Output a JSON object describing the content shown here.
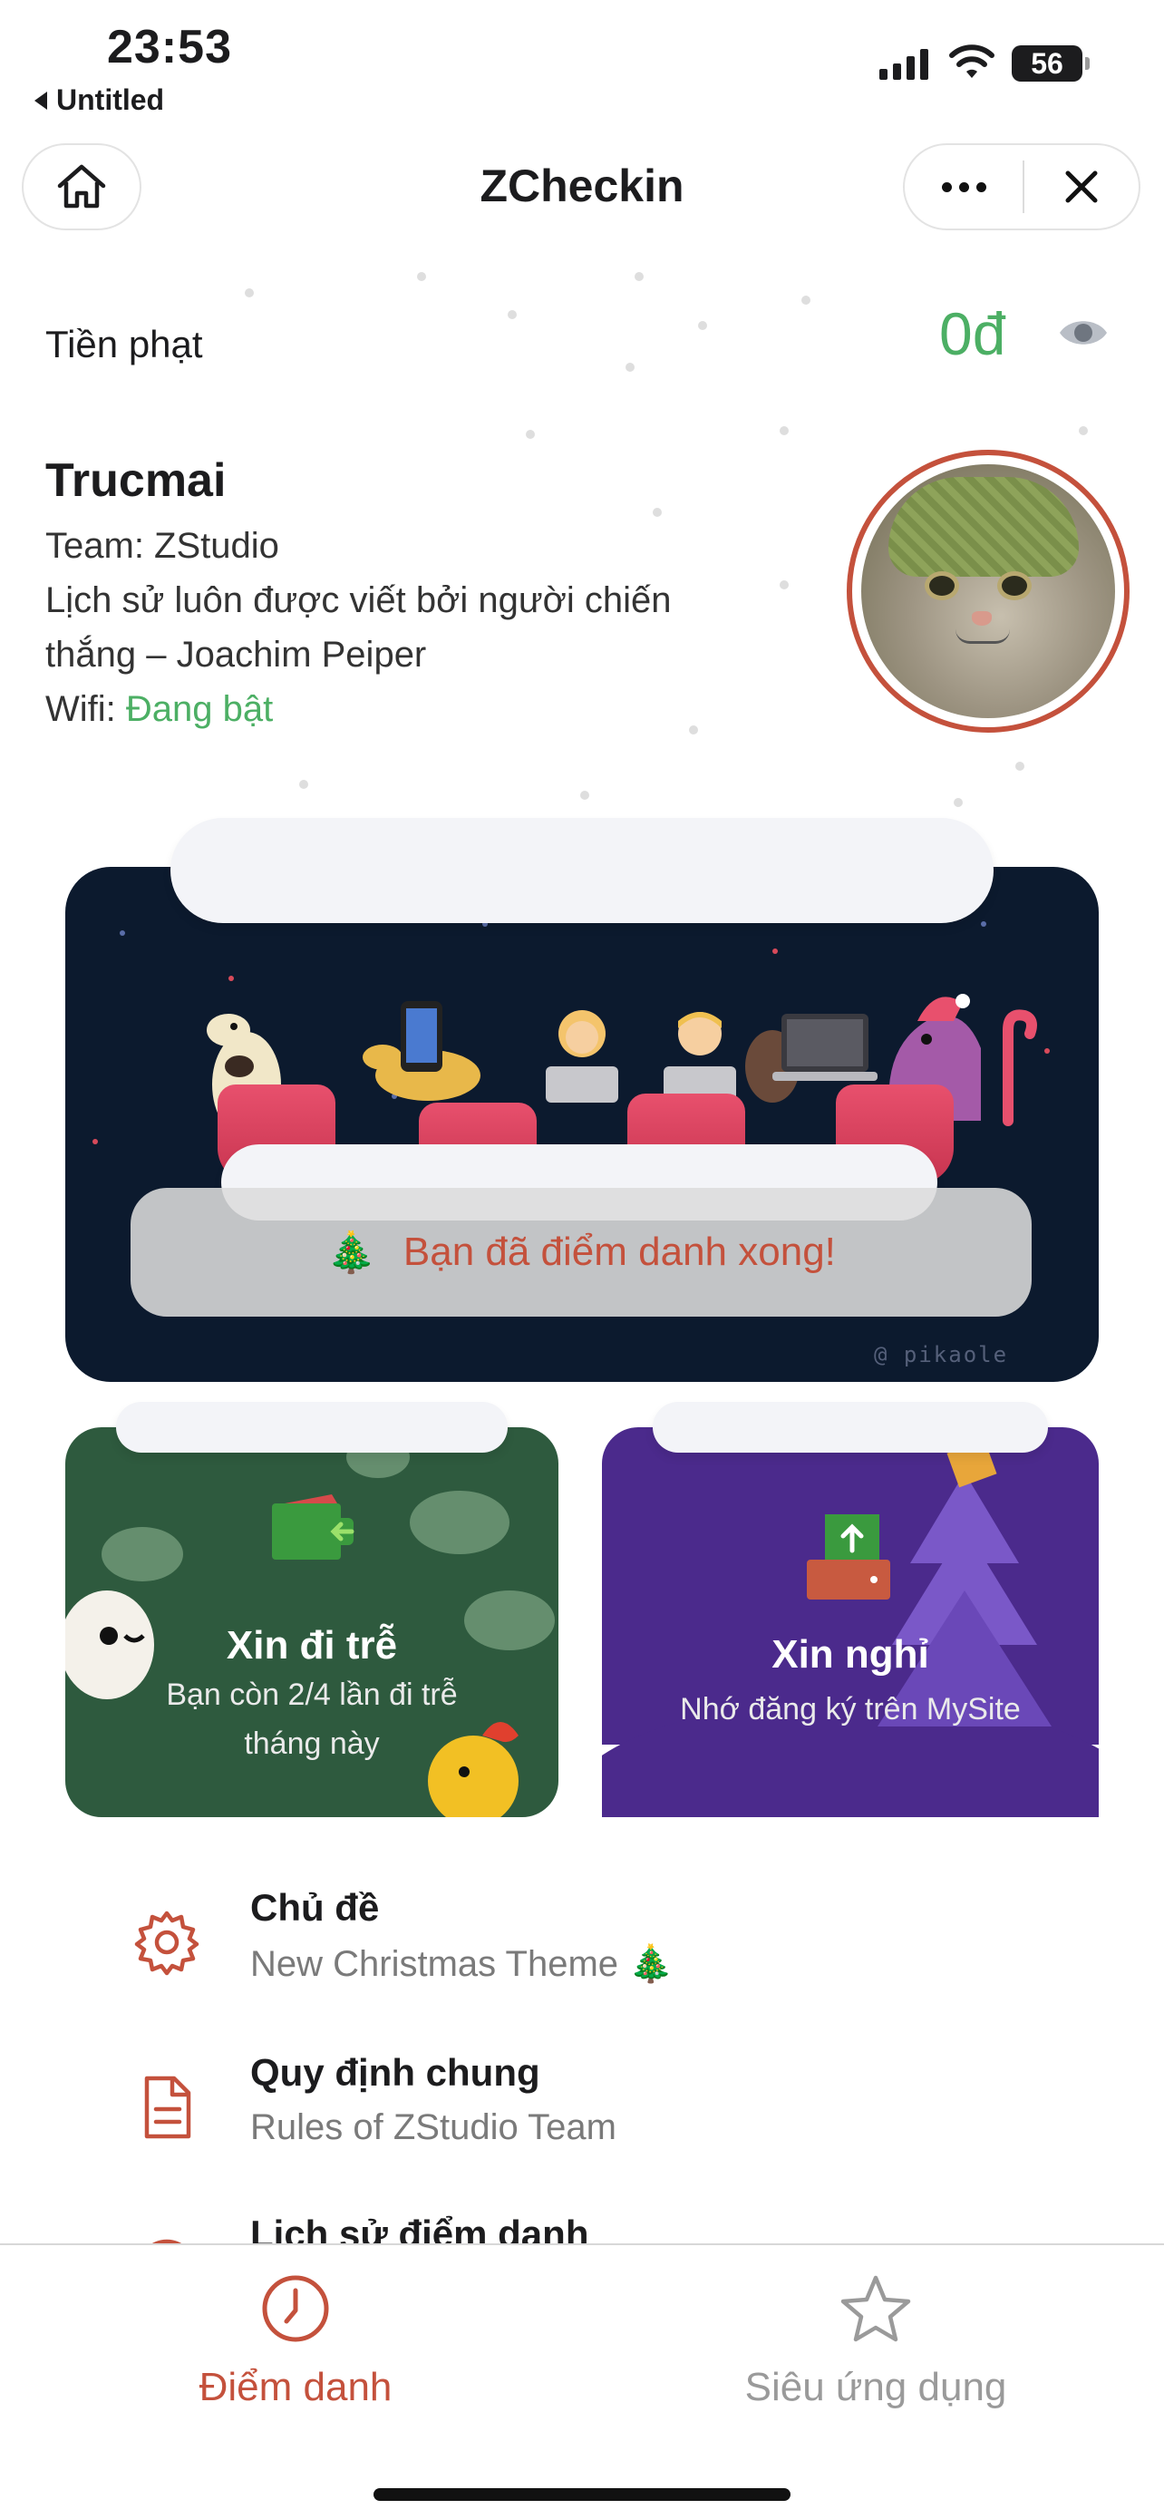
{
  "status_bar": {
    "time": "23:53",
    "back_app": "Untitled",
    "battery": "56"
  },
  "nav": {
    "title": "ZCheckin"
  },
  "fine": {
    "label": "Tiền phạt",
    "value": "0đ"
  },
  "profile": {
    "name": "Trucmai",
    "team": "Team: ZStudio",
    "quote_line1": "Lịch sử luôn được viết bởi người chiến",
    "quote_line2": "thắng – Joachim Peiper",
    "wifi_label": "Wifi: ",
    "wifi_status": "Đang bật"
  },
  "checkin_card": {
    "message": "Bạn đã điểm danh xong!",
    "tree": "🎄",
    "watermark": "@ pikaole"
  },
  "cards": {
    "late": {
      "title": "Xin đi trễ",
      "subtitle_line1": "Bạn còn 2/4 lần đi trễ",
      "subtitle_line2": "tháng này"
    },
    "leave": {
      "title": "Xin nghỉ",
      "subtitle": "Nhớ đăng ký trên MySite"
    }
  },
  "menu": [
    {
      "title": "Chủ đề",
      "subtitle": "New Christmas Theme 🎄",
      "icon": "gear-icon"
    },
    {
      "title": "Quy định chung",
      "subtitle": "Rules of ZStudio Team",
      "icon": "document-icon"
    },
    {
      "title": "Lịch sử điểm danh",
      "subtitle": "",
      "icon": "history-icon"
    }
  ],
  "tabbar": {
    "tabs": [
      {
        "label": "Điểm danh",
        "icon": "clock-icon",
        "active": true
      },
      {
        "label": "Siêu ứng dụng",
        "icon": "star-icon",
        "active": false
      }
    ]
  },
  "colors": {
    "accent": "#c4513c",
    "green": "#4caf64",
    "inactive": "#9a9a9a"
  }
}
